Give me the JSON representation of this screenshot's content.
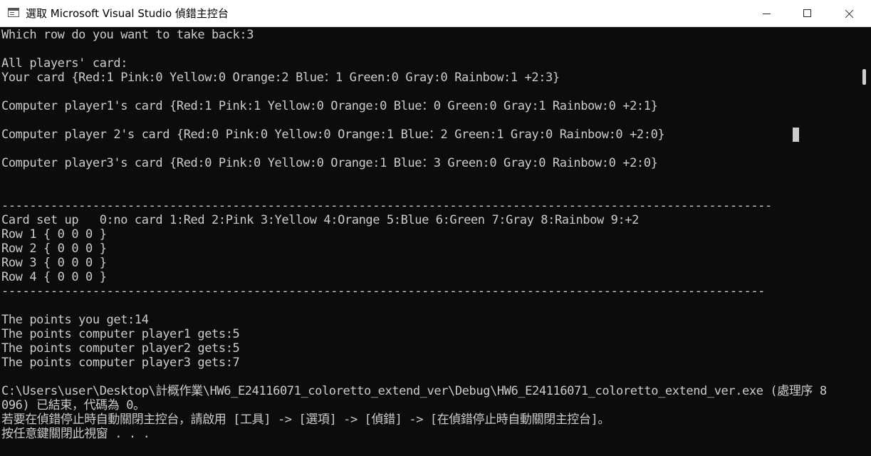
{
  "window": {
    "title": "選取 Microsoft Visual Studio 偵錯主控台",
    "icon": "console-window-icon",
    "controls": {
      "minimize": "minimize-icon",
      "maximize": "maximize-icon",
      "close": "close-icon"
    }
  },
  "console": {
    "lines": [
      "Which row do you want to take back:3",
      "",
      "All players' card:",
      "Your card {Red:1 Pink:0 Yellow:0 Orange:2 Blue：1 Green:0 Gray:0 Rainbow:1 +2:3}",
      "",
      "Computer player1's card {Red:1 Pink:1 Yellow:0 Orange:0 Blue：0 Green:0 Gray:1 Rainbow:0 +2:1}",
      "",
      "Computer player 2's card {Red:0 Pink:0 Yellow:0 Orange:1 Blue：2 Green:1 Gray:0 Rainbow:0 +2:0}",
      "",
      "Computer player3's card {Red:0 Pink:0 Yellow:0 Orange:1 Blue：3 Green:0 Gray:0 Rainbow:0 +2:0}",
      "",
      "",
      "--------------------------------------------------------------------------------------------------------------",
      "Card set up   0:no card 1:Red 2:Pink 3:Yellow 4:Orange 5:Blue 6:Green 7:Gray 8:Rainbow 9:+2",
      "Row 1 { 0 0 0 }",
      "Row 2 { 0 0 0 }",
      "Row 3 { 0 0 0 }",
      "Row 4 { 0 0 0 }",
      "-------------------------------------------------------------------------------------------------------------",
      "",
      "The points you get:14",
      "The points computer player1 gets:5",
      "The points computer player2 gets:5",
      "The points computer player3 gets:7",
      "",
      "C:\\Users\\user\\Desktop\\計概作業\\HW6_E24116071_coloretto_extend_ver\\Debug\\HW6_E24116071_coloretto_extend_ver.exe (處理序 8",
      "096) 已結束，代碼為 0。",
      "若要在偵錯停止時自動關閉主控台，請啟用 [工具] -> [選項] -> [偵錯] -> [在偵錯停止時自動關閉主控台]。",
      "按任意鍵關閉此視窗 . . ."
    ]
  },
  "colors": {
    "console_bg": "#0c0c0c",
    "console_fg": "#cccccc",
    "titlebar_bg": "#ffffff"
  }
}
